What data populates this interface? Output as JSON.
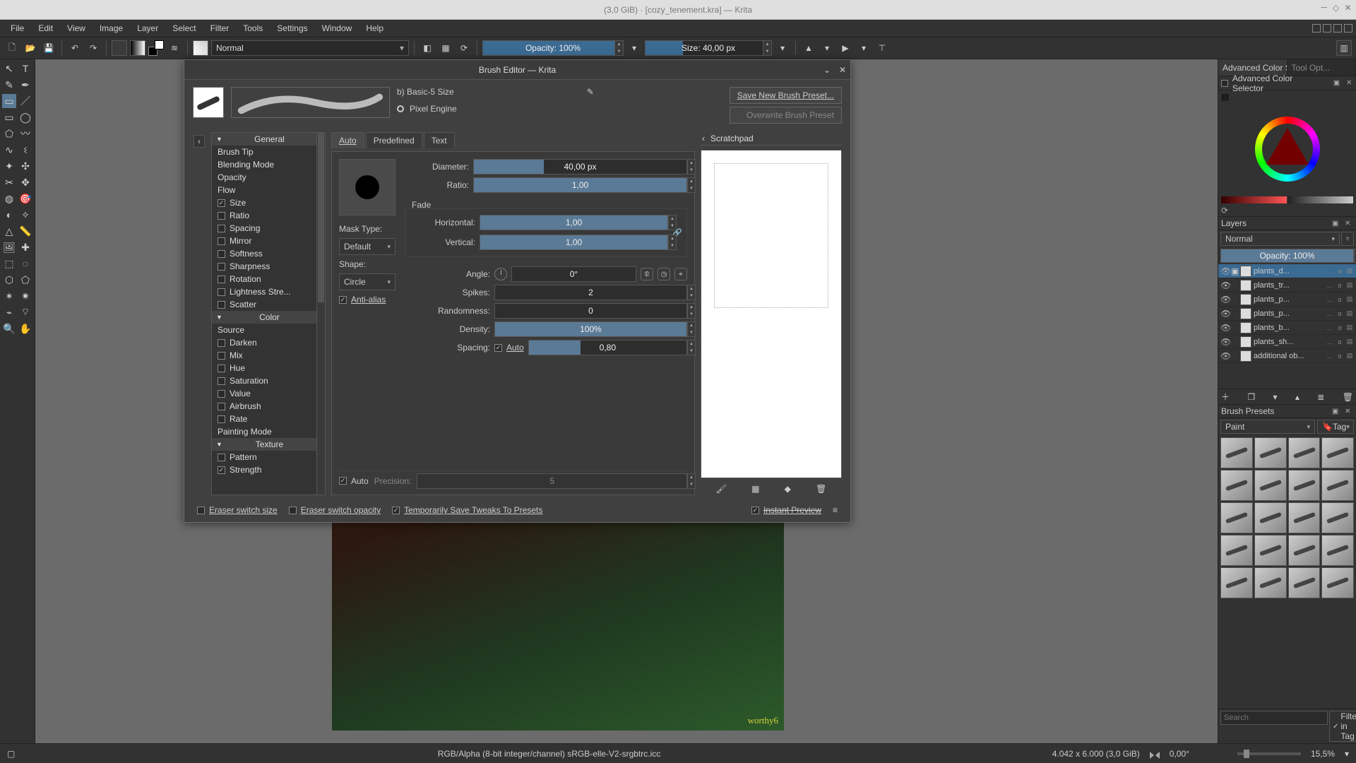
{
  "window": {
    "title": "(3,0 GiB) · [cozy_tenement.kra] — Krita"
  },
  "menus": [
    "File",
    "Edit",
    "View",
    "Image",
    "Layer",
    "Select",
    "Filter",
    "Tools",
    "Settings",
    "Window",
    "Help"
  ],
  "toolbar": {
    "blend_mode": "Normal",
    "opacity_label": "Opacity: 100%",
    "size_label": "Size: 40,00 px"
  },
  "brush_editor": {
    "title": "Brush Editor — Krita",
    "name": "b) Basic-5 Size",
    "engine": "Pixel Engine",
    "save_label": "Save New Brush Preset...",
    "overwrite_label": "Overwrite Brush Preset",
    "tabs": {
      "auto": "Auto",
      "predefined": "Predefined",
      "text": "Text"
    },
    "scratchpad_label": "Scratchpad",
    "settings_groups": {
      "general": {
        "label": "General",
        "items": [
          "Brush Tip",
          "Blending Mode",
          "Opacity",
          "Flow"
        ]
      },
      "general_chk": [
        {
          "label": "Size",
          "checked": true
        },
        {
          "label": "Ratio",
          "checked": false
        },
        {
          "label": "Spacing",
          "checked": false
        },
        {
          "label": "Mirror",
          "checked": false
        },
        {
          "label": "Softness",
          "checked": false
        },
        {
          "label": "Sharpness",
          "checked": false
        },
        {
          "label": "Rotation",
          "checked": false
        },
        {
          "label": "Lightness Stre...",
          "checked": false
        },
        {
          "label": "Scatter",
          "checked": false
        }
      ],
      "color": {
        "label": "Color",
        "source": "Source"
      },
      "color_chk": [
        {
          "label": "Darken",
          "checked": false
        },
        {
          "label": "Mix",
          "checked": false
        },
        {
          "label": "Hue",
          "checked": false
        },
        {
          "label": "Saturation",
          "checked": false
        },
        {
          "label": "Value",
          "checked": false
        },
        {
          "label": "Airbrush",
          "checked": false
        },
        {
          "label": "Rate",
          "checked": false
        }
      ],
      "painting_mode": "Painting Mode",
      "texture": {
        "label": "Texture"
      },
      "texture_chk": [
        {
          "label": "Pattern",
          "checked": false
        },
        {
          "label": "Strength",
          "checked": true
        }
      ]
    },
    "params": {
      "diameter_label": "Diameter:",
      "diameter": "40,00 px",
      "diameter_fill": 33,
      "ratio_label": "Ratio:",
      "ratio": "1,00",
      "ratio_fill": 100,
      "fade": "Fade",
      "h_label": "Horizontal:",
      "h": "1,00",
      "h_fill": 100,
      "v_label": "Vertical:",
      "v": "1,00",
      "v_fill": 100,
      "mask_label": "Mask Type:",
      "mask": "Default",
      "shape_label": "Shape:",
      "shape": "Circle",
      "aa": "Anti-alias",
      "angle_label": "Angle:",
      "angle": "0°",
      "spikes_label": "Spikes:",
      "spikes": "2",
      "random_label": "Randomness:",
      "random": "0",
      "density_label": "Density:",
      "density": "100%",
      "density_fill": 100,
      "spacing_label": "Spacing:",
      "spacing_auto": "Auto",
      "spacing": "0,80",
      "spacing_fill": 33,
      "precision_auto": "Auto",
      "precision_label": "Precision:",
      "precision": "5"
    },
    "footer": {
      "eraser_size": "Eraser switch size",
      "eraser_opacity": "Eraser switch opacity",
      "temp_save": "Temporarily Save Tweaks To Presets",
      "instant": "Instant Preview"
    }
  },
  "docks": {
    "tab_color": "Advanced Color Sele...",
    "tab_tool": "Tool Opt...",
    "color_title": "Advanced Color Selector",
    "layers_title": "Layers",
    "layers_mode": "Normal",
    "layers_opacity": "Opacity:  100%",
    "layers": [
      {
        "name": "plants_d...",
        "sel": true
      },
      {
        "name": "plants_tr..."
      },
      {
        "name": "plants_p..."
      },
      {
        "name": "plants_p..."
      },
      {
        "name": "plants_b..."
      },
      {
        "name": "plants_sh..."
      },
      {
        "name": "additional ob..."
      }
    ],
    "presets_title": "Brush Presets",
    "presets_tag": "Paint",
    "presets_tag_btn": "Tag",
    "search_ph": "Search",
    "filter_label": "Filter in Tag"
  },
  "status": {
    "profile": "RGB/Alpha (8-bit integer/channel)  sRGB-elle-V2-srgbtrc.icc",
    "dims": "4.042 x 6.000 (3,0 GiB)",
    "rot": "0,00°",
    "zoom": "15,5%"
  },
  "canvas": {
    "signature": "worthy6"
  }
}
